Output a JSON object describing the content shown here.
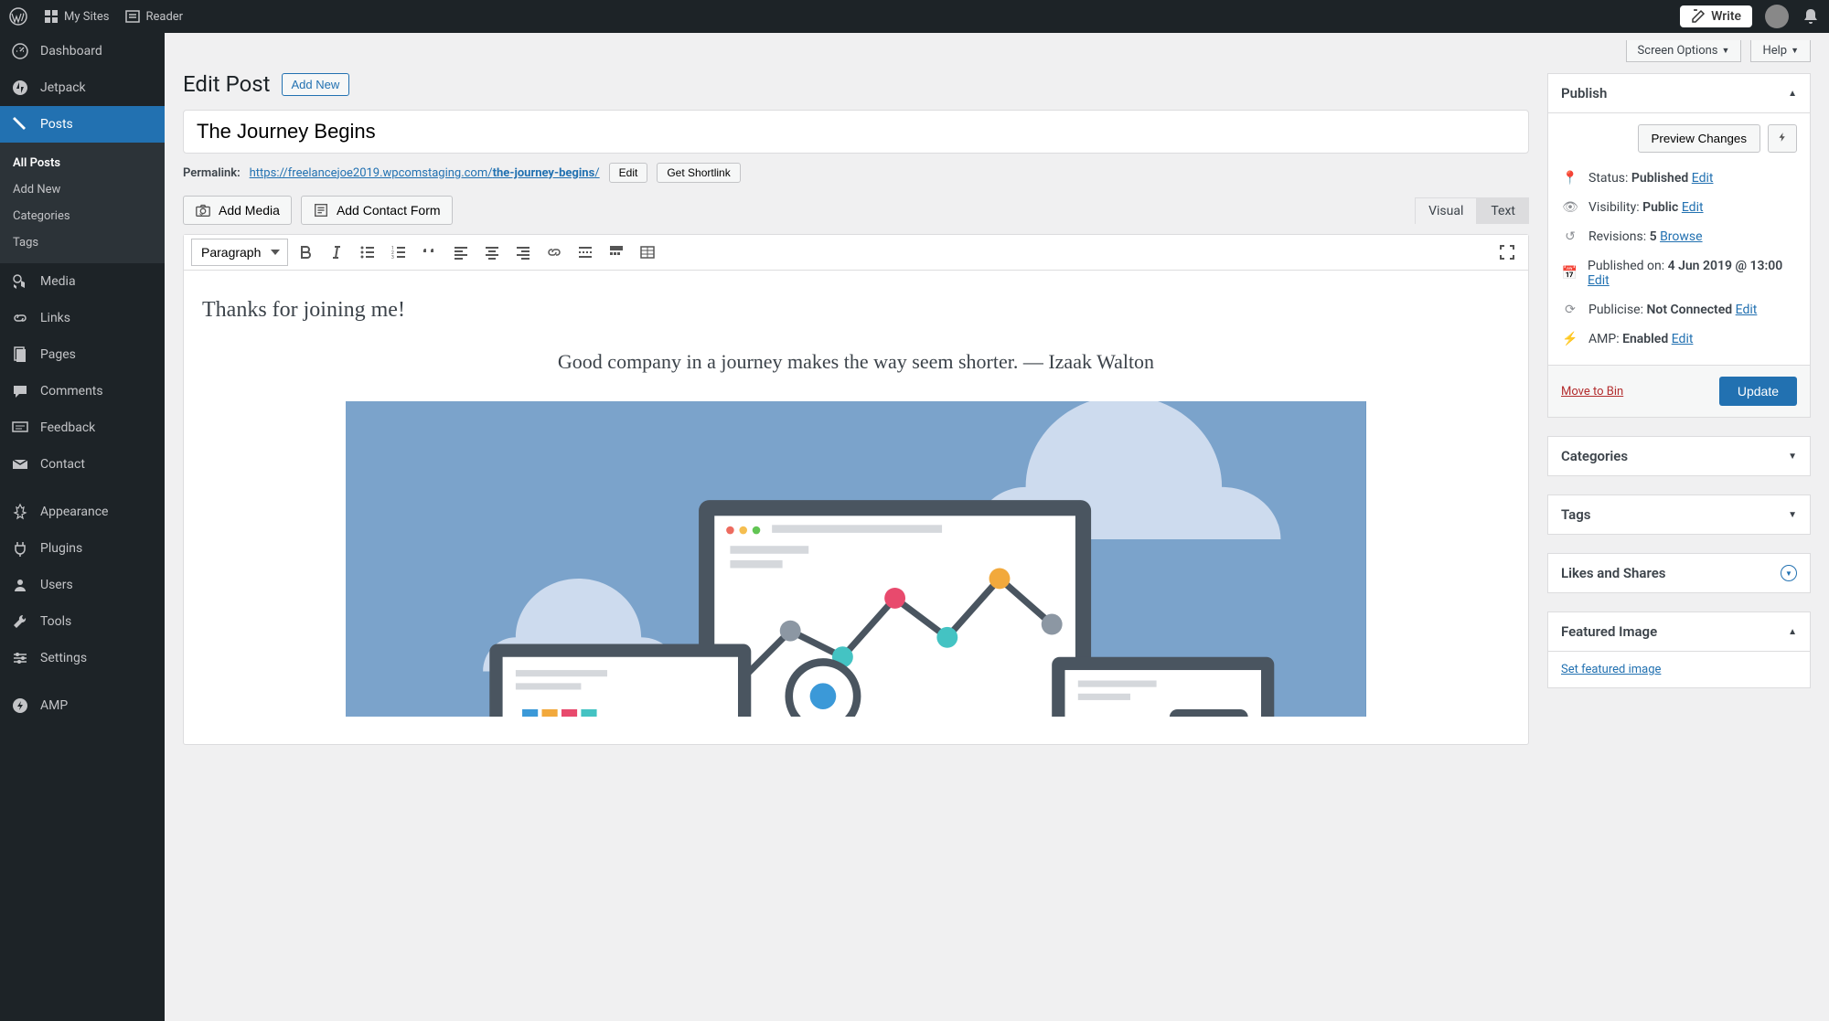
{
  "topbar": {
    "my_sites": "My Sites",
    "reader": "Reader",
    "write": "Write"
  },
  "sidebar": {
    "dashboard": "Dashboard",
    "jetpack": "Jetpack",
    "posts": "Posts",
    "all_posts": "All Posts",
    "add_new": "Add New",
    "categories": "Categories",
    "tags": "Tags",
    "media": "Media",
    "links": "Links",
    "pages": "Pages",
    "comments": "Comments",
    "feedback": "Feedback",
    "contact": "Contact",
    "appearance": "Appearance",
    "plugins": "Plugins",
    "users": "Users",
    "tools": "Tools",
    "settings": "Settings",
    "amp": "AMP"
  },
  "screen": {
    "screen_options": "Screen Options",
    "help": "Help"
  },
  "page": {
    "title": "Edit Post",
    "add_new": "Add New",
    "post_title": "The Journey Begins"
  },
  "permalink": {
    "label": "Permalink:",
    "base": "https://freelancejoe2019.wpcomstaging.com/",
    "slug": "the-journey-begins",
    "trail": "/",
    "edit": "Edit",
    "shortlink": "Get Shortlink"
  },
  "editor": {
    "add_media": "Add Media",
    "add_contact_form": "Add Contact Form",
    "format": "Paragraph",
    "tab_visual": "Visual",
    "tab_text": "Text",
    "greeting": "Thanks for joining me!",
    "quote": "Good company in a journey makes the way seem shorter. — Izaak Walton"
  },
  "publish": {
    "title": "Publish",
    "preview_changes": "Preview Changes",
    "status_label": "Status:",
    "status_value": "Published",
    "visibility_label": "Visibility:",
    "visibility_value": "Public",
    "revisions_label": "Revisions:",
    "revisions_value": "5",
    "browse": "Browse",
    "published_label": "Published on:",
    "published_value": "4 Jun 2019 @ 13:00",
    "publicise_label": "Publicise:",
    "publicise_value": "Not Connected",
    "amp_label": "AMP:",
    "amp_value": "Enabled",
    "edit": "Edit",
    "move_to_bin": "Move to Bin",
    "update": "Update"
  },
  "boxes": {
    "categories": "Categories",
    "tags": "Tags",
    "likes": "Likes and Shares",
    "featured_image": "Featured Image",
    "set_featured": "Set featured image"
  }
}
